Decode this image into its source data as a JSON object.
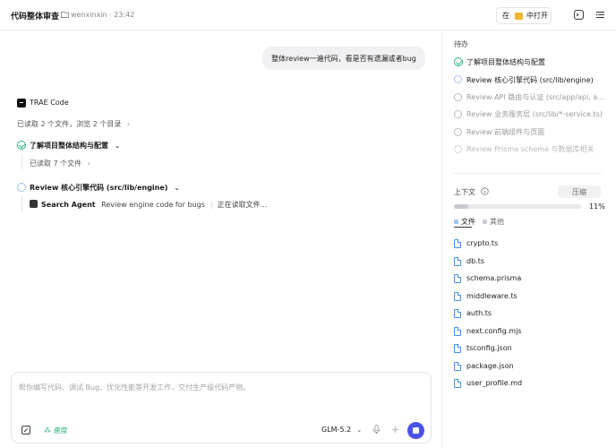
{
  "header": {
    "title": "代码整体审查",
    "owner": "wenxinxin · 23:42",
    "open_in": "在",
    "open_target": "中打开"
  },
  "chat": {
    "user_message": "整体review一遍代码，看是否有遗漏或者bug",
    "assistant_name": "TRAE Code",
    "read_summary": "已读取 2 个文件，浏览 2 个目录",
    "steps": [
      {
        "label": "了解项目整体结构与配置",
        "detail": "已读取 7 个文件"
      },
      {
        "label": "Review 核心引擎代码 (src/lib/engine)",
        "agent": "Search Agent",
        "task": "Review engine code for bugs",
        "status": "正在读取文件..."
      }
    ]
  },
  "input": {
    "placeholder": "帮你编写代码、调试 Bug、优化性能等开发工作，交付生产级代码产物。",
    "mode": "速度",
    "model": "GLM-5.2"
  },
  "todo": {
    "title": "待办",
    "items": [
      {
        "label": "了解项目整体结构与配置",
        "state": "done"
      },
      {
        "label": "Review 核心引擎代码 (src/lib/engine)",
        "state": "running"
      },
      {
        "label": "Review API 路由与认证 (src/app/api, a...",
        "state": "pending"
      },
      {
        "label": "Review 业务服务层 (src/lib/*-service.ts)",
        "state": "pending"
      },
      {
        "label": "Review 前端组件与页面",
        "state": "pending"
      },
      {
        "label": "Review Prisma schema 与数据库相关",
        "state": "pending"
      }
    ]
  },
  "context": {
    "title": "上下文",
    "compress_label": "压缩",
    "usage_percent": 11,
    "usage_label": "11%",
    "legend_files": "文件",
    "legend_other": "其他",
    "files": [
      "crypto.ts",
      "db.ts",
      "schema.prisma",
      "middleware.ts",
      "auth.ts",
      "next.config.mjs",
      "tsconfig.json",
      "package.json",
      "user_profile.md"
    ]
  },
  "colors": {
    "accent": "#4b52e6",
    "done": "#2db37a",
    "running": "#4a7df7",
    "file_icon": "#3d8ef0"
  }
}
